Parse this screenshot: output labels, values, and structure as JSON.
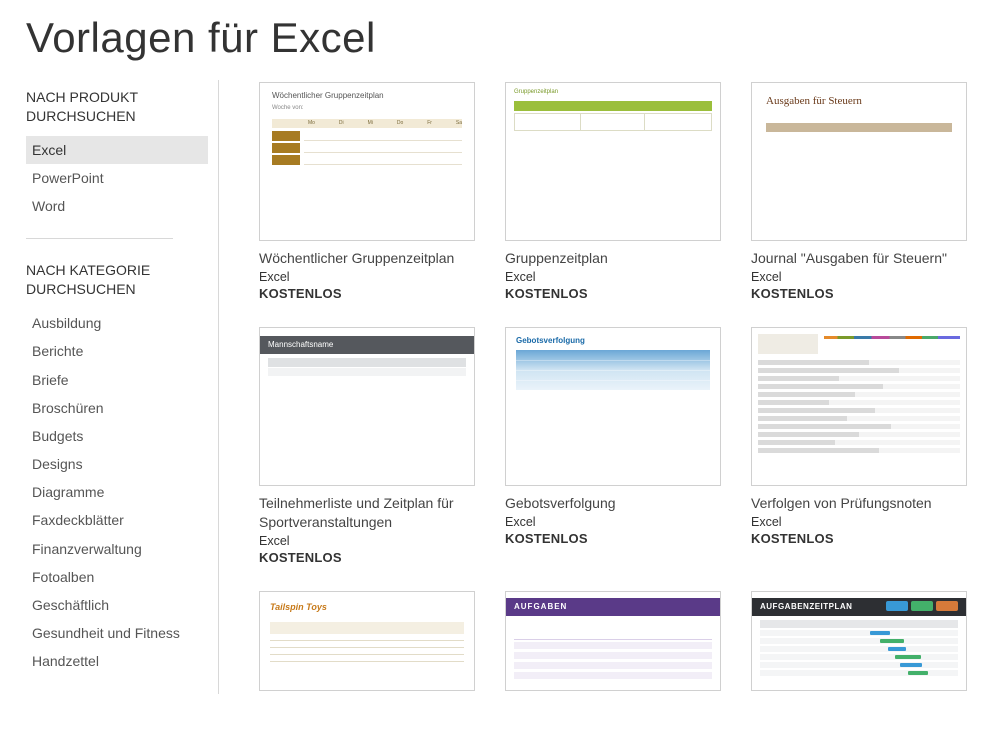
{
  "page": {
    "title": "Vorlagen für Excel"
  },
  "sidebar": {
    "product_heading": "NACH PRODUKT DURCHSUCHEN",
    "products": [
      {
        "label": "Excel",
        "selected": true
      },
      {
        "label": "PowerPoint",
        "selected": false
      },
      {
        "label": "Word",
        "selected": false
      }
    ],
    "category_heading": "NACH KATEGORIE DURCHSUCHEN",
    "categories": [
      "Ausbildung",
      "Berichte",
      "Briefe",
      "Broschüren",
      "Budgets",
      "Designs",
      "Diagramme",
      "Faxdeckblätter",
      "Finanzverwaltung",
      "Fotoalben",
      "Geschäftlich",
      "Gesundheit und Fitness",
      "Handzettel"
    ]
  },
  "templates": [
    {
      "title": "Wöchentlicher Gruppenzeitplan",
      "app": "Excel",
      "price": "KOSTENLOS",
      "thumb": {
        "variant": "t0",
        "heading": "Wöchentlicher Gruppenzeitplan",
        "sub": "Woche von:",
        "cols": [
          "Mo",
          "Di",
          "Mi",
          "Do",
          "Fr",
          "Sa"
        ]
      }
    },
    {
      "title": "Gruppenzeitplan",
      "app": "Excel",
      "price": "KOSTENLOS",
      "thumb": {
        "variant": "t1",
        "top": "Gruppenzeitplan"
      }
    },
    {
      "title": "Journal \"Ausgaben für Steuern\"",
      "app": "Excel",
      "price": "KOSTENLOS",
      "thumb": {
        "variant": "t2",
        "title": "Ausgaben für Steuern"
      }
    },
    {
      "title": "Teilnehmerliste und Zeitplan für Sportveranstaltungen",
      "app": "Excel",
      "price": "KOSTENLOS",
      "thumb": {
        "variant": "t3",
        "title": "Mannschaftsname"
      }
    },
    {
      "title": "Gebotsverfolgung",
      "app": "Excel",
      "price": "KOSTENLOS",
      "thumb": {
        "variant": "t4",
        "title": "Gebotsverfolgung"
      }
    },
    {
      "title": "Verfolgen von Prüfungsnoten",
      "app": "Excel",
      "price": "KOSTENLOS",
      "thumb": {
        "variant": "t5"
      }
    },
    {
      "title": "",
      "app": "",
      "price": "",
      "thumb": {
        "variant": "t6",
        "title": "Tailspin Toys"
      },
      "partial": true
    },
    {
      "title": "",
      "app": "",
      "price": "",
      "thumb": {
        "variant": "t7",
        "title": "AUFGABEN"
      },
      "partial": true
    },
    {
      "title": "",
      "app": "",
      "price": "",
      "thumb": {
        "variant": "t8",
        "title": "AUFGABENZEITPLAN"
      },
      "partial": true
    }
  ]
}
